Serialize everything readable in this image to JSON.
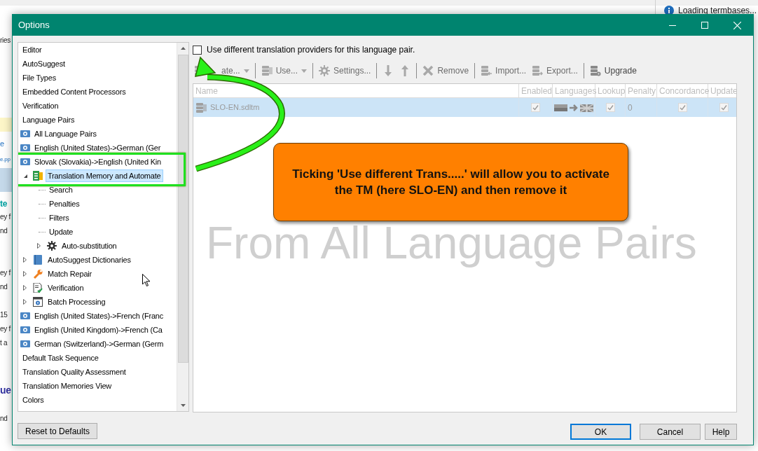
{
  "background_app": {
    "fragments": [
      {
        "text": "ries",
        "kind": "plain"
      },
      {
        "text": "e",
        "kind": "tab"
      },
      {
        "text": "e.pp",
        "kind": "link"
      },
      {
        "text": "te",
        "kind": "heading"
      },
      {
        "text": "ey f",
        "kind": "plain"
      },
      {
        "text": "nd",
        "kind": "plain"
      },
      {
        "text": "ey f",
        "kind": "plain"
      },
      {
        "text": "nd",
        "kind": "plain"
      },
      {
        "text": "15",
        "kind": "plain"
      },
      {
        "text": "ey f",
        "kind": "plain"
      },
      {
        "text": "t a",
        "kind": "plain"
      },
      {
        "text": "ue",
        "kind": "title"
      },
      {
        "text": "nd",
        "kind": "plain"
      }
    ],
    "notification": "Loading termbases..."
  },
  "window": {
    "title": "Options"
  },
  "tree": {
    "items": [
      {
        "label": "Editor",
        "kind": "plain",
        "selected": false
      },
      {
        "label": "AutoSuggest",
        "kind": "plain",
        "selected": false
      },
      {
        "label": "File Types",
        "kind": "plain",
        "selected": false
      },
      {
        "label": "Embedded Content Processors",
        "kind": "plain",
        "selected": false
      },
      {
        "label": "Verification",
        "kind": "plain",
        "selected": false
      },
      {
        "label": "Language Pairs",
        "kind": "plain",
        "selected": false
      },
      {
        "label": "All Language Pairs",
        "kind": "pair",
        "selected": false
      },
      {
        "label": "English (United States)->German (Ger",
        "kind": "pair",
        "selected": false
      },
      {
        "label": "Slovak (Slovakia)->English (United Kin",
        "kind": "pair",
        "selected": false,
        "children": [
          {
            "label": "Translation Memory and Automate",
            "kind": "tm",
            "selected": true,
            "expanded": true,
            "children": [
              {
                "label": "Search",
                "kind": "plain",
                "selected": false
              },
              {
                "label": "Penalties",
                "kind": "plain",
                "selected": false
              },
              {
                "label": "Filters",
                "kind": "plain",
                "selected": false
              },
              {
                "label": "Update",
                "kind": "plain",
                "selected": false
              },
              {
                "label": "Auto-substitution",
                "kind": "gear",
                "selected": false,
                "expanded": false
              }
            ]
          },
          {
            "label": "AutoSuggest Dictionaries",
            "kind": "dictionary",
            "selected": false,
            "expanded": false
          },
          {
            "label": "Match Repair",
            "kind": "repair",
            "selected": false,
            "expanded": false
          },
          {
            "label": "Verification",
            "kind": "verification",
            "selected": false,
            "expanded": false
          },
          {
            "label": "Batch Processing",
            "kind": "batch",
            "selected": false,
            "expanded": false
          }
        ]
      },
      {
        "label": "English (United States)->French (Franc",
        "kind": "pair",
        "selected": false
      },
      {
        "label": "English (United Kingdom)->French (Ca",
        "kind": "pair",
        "selected": false
      },
      {
        "label": "German (Switzerland)->German (Germ",
        "kind": "pair",
        "selected": false
      },
      {
        "label": "Default Task Sequence",
        "kind": "plain",
        "selected": false
      },
      {
        "label": "Translation Quality Assessment",
        "kind": "plain",
        "selected": false
      },
      {
        "label": "Translation Memories View",
        "kind": "plain",
        "selected": false
      },
      {
        "label": "Colors",
        "kind": "plain",
        "selected": false
      }
    ]
  },
  "reset_button": "Reset to Defaults",
  "provider_checkbox": {
    "label": "Use different translation providers for this language pair.",
    "checked": false
  },
  "toolbar": {
    "groups": [
      [
        {
          "kind": "database",
          "label": "ate...",
          "dropdown": true,
          "disabled": true
        }
      ],
      [
        {
          "kind": "database",
          "label": "Use...",
          "dropdown": true,
          "disabled": true
        }
      ],
      [
        {
          "kind": "gear",
          "label": "Settings...",
          "dropdown": false,
          "disabled": true
        }
      ],
      [
        {
          "kind": "down",
          "dropdown": false,
          "disabled": true
        },
        {
          "kind": "up",
          "dropdown": false,
          "disabled": true
        }
      ],
      [
        {
          "kind": "delete",
          "label": "Remove",
          "dropdown": false,
          "disabled": true
        }
      ],
      [
        {
          "kind": "import",
          "label": "Import...",
          "dropdown": false,
          "disabled": true
        },
        {
          "kind": "export",
          "label": "Export...",
          "dropdown": false,
          "disabled": true
        }
      ],
      [
        {
          "kind": "upgrade",
          "label": "Upgrade",
          "dropdown": false,
          "disabled": false
        }
      ]
    ]
  },
  "table": {
    "columns": [
      "Name",
      "Enabled",
      "Languages",
      "Lookup",
      "Penalty",
      "Concordance",
      "Update"
    ],
    "rows": [
      {
        "selected": true,
        "disabled": true,
        "name": "SLO-EN.sdltm",
        "enabled": true,
        "lookup": true,
        "penalty": "0",
        "concordance": true,
        "update": true
      }
    ]
  },
  "overlay_caption": "From All Language Pairs",
  "callout": {
    "text": "Ticking 'Use different Trans.....' will allow you to activate the TM (here SLO-EN) and then remove it"
  },
  "buttons": [
    {
      "label": "OK",
      "default": true
    },
    {
      "label": "Cancel",
      "default": false
    },
    {
      "label": "Help",
      "default": false
    }
  ]
}
